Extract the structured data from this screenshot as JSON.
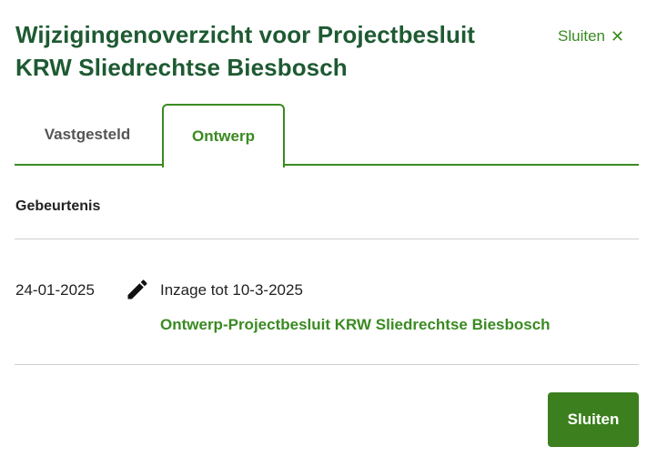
{
  "dialog": {
    "title": "Wijzigingenoverzicht voor Projectbesluit KRW Sliedrechtse Biesbosch",
    "close_link_label": "Sluiten",
    "close_link_icon": "close-x-icon"
  },
  "tabs": [
    {
      "label": "Vastgesteld",
      "active": false
    },
    {
      "label": "Ontwerp",
      "active": true
    }
  ],
  "table": {
    "header": "Gebeurtenis",
    "rows": [
      {
        "date": "24-01-2025",
        "icon": "pencil-icon",
        "description": "Inzage tot 10-3-2025",
        "link_text": "Ontwerp-Projectbesluit KRW Sliedrechtse Biesbosch"
      }
    ]
  },
  "footer": {
    "close_button_label": "Sluiten"
  },
  "colors": {
    "title": "#1e5a32",
    "accent": "#3a8a22",
    "button": "#3c7f1e",
    "text": "#222222"
  }
}
